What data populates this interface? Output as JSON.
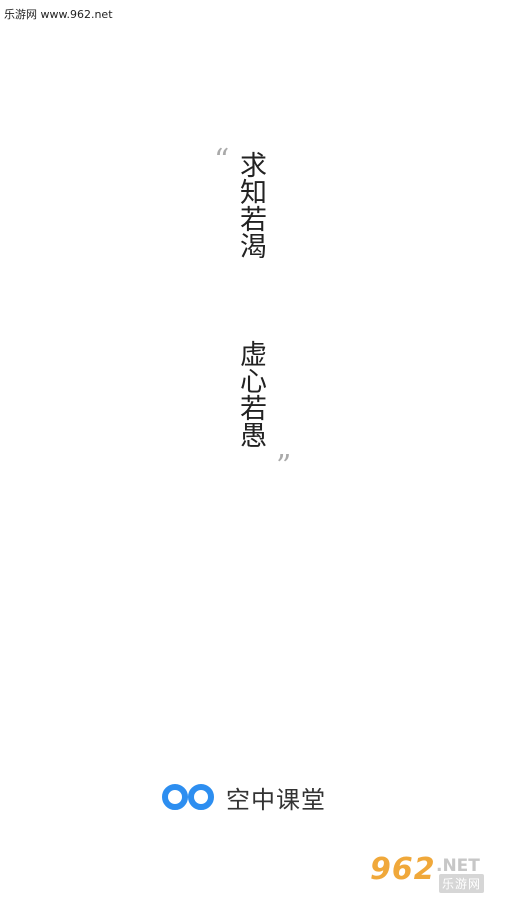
{
  "watermark": {
    "text": "乐游网 www.962.net"
  },
  "quote": {
    "open_mark": "“",
    "close_mark": "”",
    "line1": "求知若渴",
    "line2": "虚心若愚"
  },
  "brand": {
    "name": "空中课堂",
    "logo_icon": "double-ring-logo-icon",
    "accent_color": "#2d8ef0"
  },
  "badge": {
    "number": "962",
    "suffix": ".NET",
    "cn_name": "乐游网"
  }
}
